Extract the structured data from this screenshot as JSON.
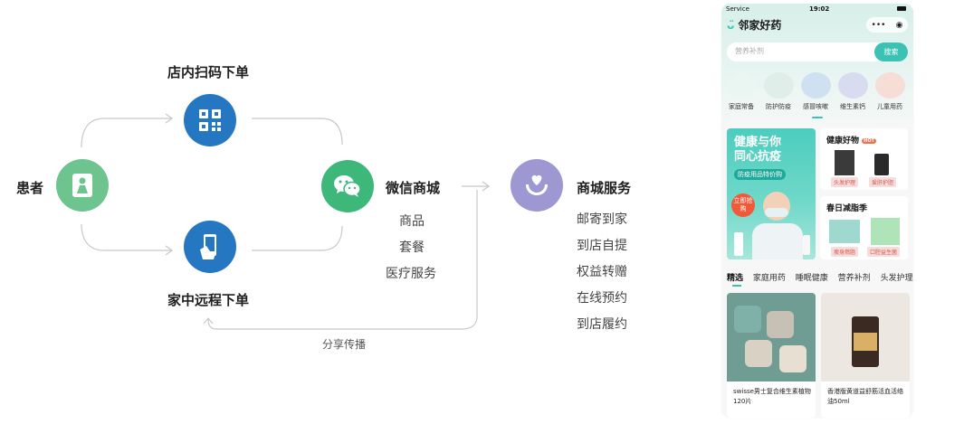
{
  "flow": {
    "scan_label": "店内扫码下单",
    "patient_label": "患者",
    "remote_label": "家中远程下单",
    "wechat_label": "微信商城",
    "wechat_items": [
      "商品",
      "套餐",
      "医疗服务"
    ],
    "service_label": "商城服务",
    "service_items": [
      "邮寄到家",
      "到店自提",
      "权益转赠",
      "在线预约",
      "到店履约"
    ],
    "share_label": "分享传播",
    "colors": {
      "patient": "#6dc48f",
      "scan": "#2677c2",
      "remote": "#2677c2",
      "wechat": "#3eb87a",
      "service": "#9d97d2",
      "line": "#c8c8c8"
    },
    "icons": {
      "patient": "person-icon",
      "scan": "qr-code-icon",
      "remote": "phone-hand-icon",
      "wechat": "wechat-icon",
      "service": "heart-hand-icon"
    }
  },
  "phone": {
    "status_left": "Service",
    "status_time": "19:02",
    "app_name": "邻家好药",
    "capsule": "•••  ⦿",
    "search_placeholder": "营养补剂",
    "search_button": "搜索",
    "categories": [
      "家庭常备",
      "防护防疫",
      "感冒咳嗽",
      "维生素钙",
      "儿童用药"
    ],
    "banner": {
      "title_line1": "健康与你",
      "title_line2": "同心抗疫",
      "tag": "防疫用品特价购",
      "badge": "立即抢购"
    },
    "card1": {
      "title": "健康好物",
      "hot": "HOT",
      "pill1": "头发护理",
      "pill2": "爱肝护胆"
    },
    "card2": {
      "title": "春日减脂季",
      "pill1": "瘦身燃脂",
      "pill2": "口腔益生菌"
    },
    "tabs": [
      "精选",
      "家庭用药",
      "睡眠健康",
      "营养补剂",
      "头发护理"
    ],
    "products": [
      {
        "name": "swisse男士复合维生素植物120片"
      },
      {
        "name": "香港版黄道益舒筋活血活络油50ml"
      }
    ],
    "accent": "#3cc2b4"
  }
}
